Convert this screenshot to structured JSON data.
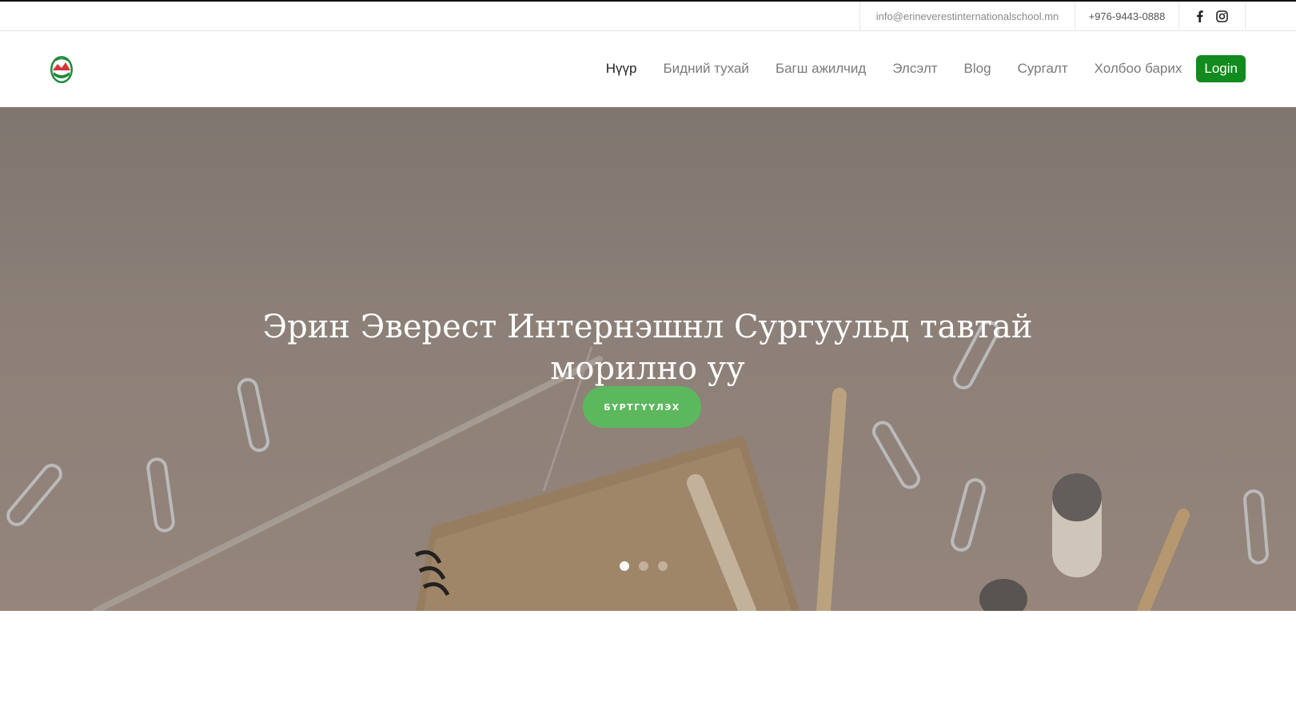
{
  "topbar": {
    "email": "info@erineverestinternationalschool.mn",
    "phone": "+976-9443-0888",
    "social": [
      {
        "icon": "facebook-icon"
      },
      {
        "icon": "instagram-icon"
      }
    ]
  },
  "nav": {
    "items": [
      {
        "label": "Нүүр",
        "active": true
      },
      {
        "label": "Бидний тухай"
      },
      {
        "label": "Багш ажилчид"
      },
      {
        "label": "Элсэлт"
      },
      {
        "label": "Blog"
      },
      {
        "label": "Сургалт"
      },
      {
        "label": "Холбоо барих"
      }
    ],
    "login_label": "Login"
  },
  "hero": {
    "title": "Эрин Эверест Интернэшнл Сургуульд тавтай морилно уу",
    "button_label": "БҮРТГҮҮЛЭХ",
    "slide_count": 3,
    "active_slide": 1
  },
  "colors": {
    "login_bg": "#118a1e",
    "cta_bg": "#5cb85c",
    "logo_green": "#1f8a3a",
    "logo_red": "#d8333b"
  }
}
